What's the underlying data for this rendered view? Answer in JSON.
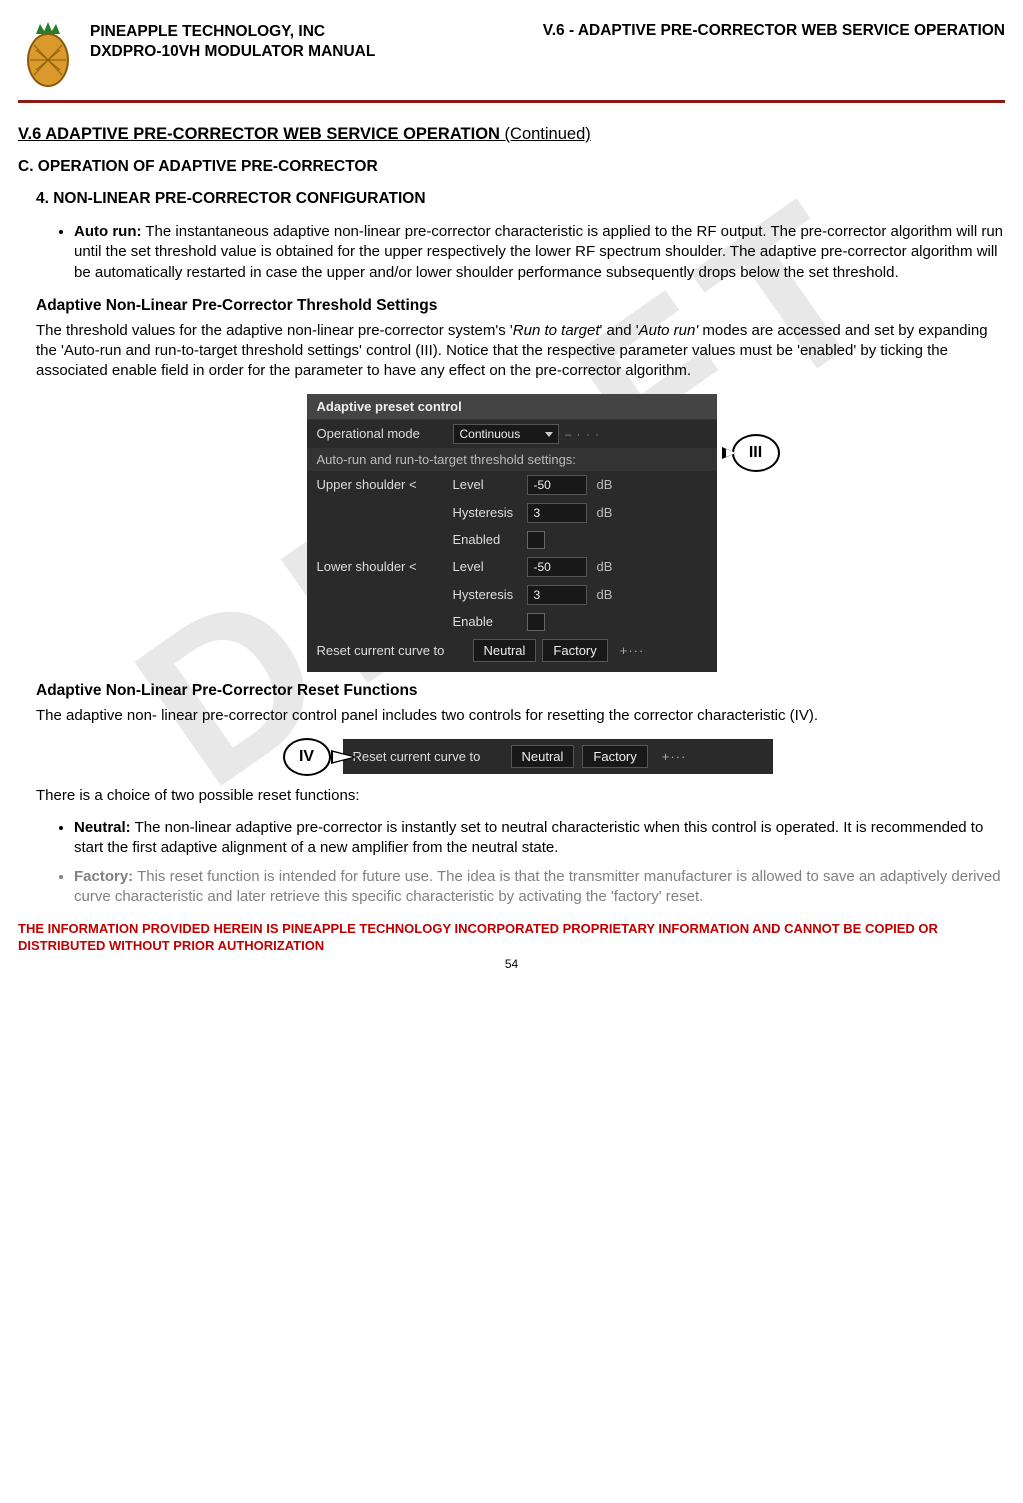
{
  "watermark": "DRAFT",
  "header": {
    "company": "PINEAPPLE TECHNOLOGY, INC",
    "manual": "DXDPRO-10VH MODULATOR MANUAL",
    "doc_title": "V.6 - ADAPTIVE PRE-CORRECTOR WEB SERVICE OPERATION"
  },
  "section_title": "V.6  ADAPTIVE PRE-CORRECTOR WEB SERVICE OPERATION",
  "continued": "(Continued)",
  "sub_c": "C.   OPERATION OF ADAPTIVE PRE-CORRECTOR",
  "sub_4": "4. NON-LINEAR PRE-CORRECTOR CONFIGURATION",
  "bullet_autorun_label": "Auto run:",
  "bullet_autorun_text": " The instantaneous adaptive non-linear pre-corrector characteristic is applied to the RF output. The pre-corrector algorithm will run until the set threshold value is obtained for the upper respectively the lower RF spectrum shoulder. The adaptive pre-corrector algorithm will be automatically restarted in case the upper and/or lower shoulder performance subsequently drops below the set threshold.",
  "threshold_heading": "Adaptive Non-Linear Pre-Corrector Threshold Settings",
  "threshold_para_1": "The threshold values for the adaptive non-linear pre-corrector system's '",
  "threshold_para_rtt": "Run to target",
  "threshold_para_2": "' and '",
  "threshold_para_ar": "Auto run'",
  "threshold_para_3": " modes  are accessed and set by expanding the 'Auto-run and run-to-target threshold settings' control (III). Notice that the respective parameter values must be 'enabled' by ticking the associated enable field in order for the parameter to have any effect on the pre-corrector algorithm.",
  "panel": {
    "title": "Adaptive preset control",
    "op_mode_label": "Operational mode",
    "op_mode_value": "Continuous",
    "section_label": "Auto-run and run-to-target threshold settings:",
    "upper_label": "Upper shoulder <",
    "lower_label": "Lower shoulder <",
    "level_label": "Level",
    "hyst_label": "Hysteresis",
    "enabled_label": "Enabled",
    "enable_label": "Enable",
    "upper_level": "-50",
    "upper_hyst": "3",
    "lower_level": "-50",
    "lower_hyst": "3",
    "db": "dB",
    "reset_label": "Reset current curve to",
    "btn_neutral": "Neutral",
    "btn_factory": "Factory",
    "ext": "+···"
  },
  "callout3": "III",
  "reset_heading": "Adaptive Non-Linear Pre-Corrector Reset Functions",
  "reset_para": "The adaptive non- linear pre-corrector control panel includes two controls for resetting the corrector characteristic (IV).",
  "callout4": "IV",
  "choice_para": "There is a choice of two possible reset functions:",
  "bullet_neutral_label": "Neutral:",
  "bullet_neutral_text": " The non-linear adaptive pre-corrector is instantly set to neutral characteristic when this control is operated. It is recommended to start the first adaptive alignment of a new amplifier from the neutral state.",
  "bullet_factory_label": "Factory:",
  "bullet_factory_text": " This reset function is intended for future use. The idea is that the transmitter manufacturer is allowed to save an adaptively derived curve characteristic and later retrieve this specific characteristic by activating the 'factory' reset.",
  "footer_red": "THE INFORMATION PROVIDED HEREIN IS PINEAPPLE TECHNOLOGY INCORPORATED PROPRIETARY INFORMATION AND CANNOT BE COPIED OR DISTRIBUTED WITHOUT PRIOR AUTHORIZATION",
  "page_num": "54"
}
